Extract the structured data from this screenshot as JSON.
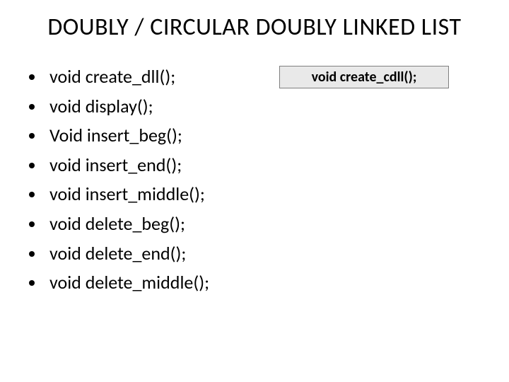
{
  "title": "DOUBLY / CIRCULAR DOUBLY LINKED LIST",
  "list": {
    "items": [
      "void create_dll();",
      "void display();",
      "Void insert_beg();",
      "void insert_end();",
      "void insert_middle();",
      "void delete_beg();",
      "void delete_end();",
      "void delete_middle();"
    ]
  },
  "callout": {
    "text": "void create_cdll();"
  }
}
